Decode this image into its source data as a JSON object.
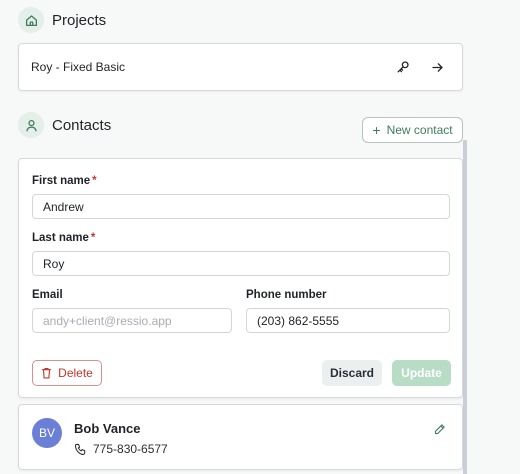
{
  "projects": {
    "title": "Projects",
    "item": {
      "name": "Roy - Fixed Basic"
    }
  },
  "contacts": {
    "title": "Contacts",
    "new_button": "New contact",
    "form": {
      "first_name_label": "First name",
      "first_name_value": "Andrew",
      "last_name_label": "Last name",
      "last_name_value": "Roy",
      "email_label": "Email",
      "email_placeholder": "andy+client@ressio.app",
      "phone_label": "Phone number",
      "phone_value": "(203) 862-5555",
      "required_mark": "*",
      "delete_label": "Delete",
      "discard_label": "Discard",
      "update_label": "Update"
    },
    "list": [
      {
        "initials": "BV",
        "name": "Bob Vance",
        "phone": "775-830-6577"
      }
    ]
  },
  "colors": {
    "accent": "#3f7c5e",
    "danger": "#c4362c",
    "avatar": "#6b7fd7",
    "update_disabled": "#b8dcc6"
  }
}
